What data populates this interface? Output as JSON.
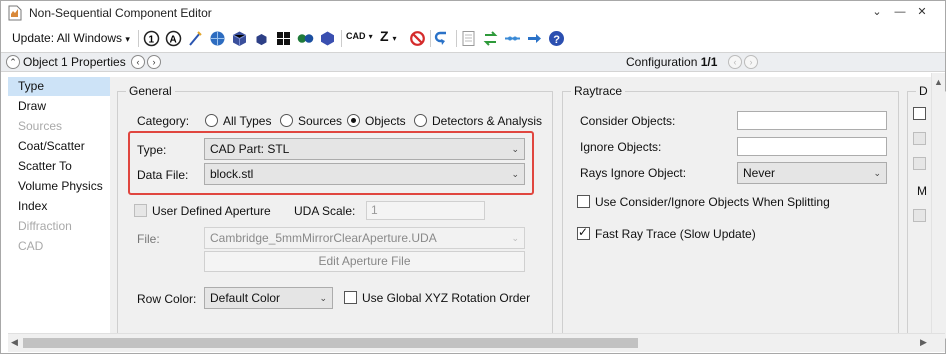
{
  "window": {
    "title": "Non-Sequential Component Editor"
  },
  "toolbar": {
    "update_label": "Update: All Windows",
    "cad_label": "CAD",
    "z_label": "Z",
    "icons": [
      "one-icon",
      "a-icon",
      "wand-icon",
      "globe-icon",
      "cube-icon",
      "cube-small-icon",
      "grid-icon",
      "spheres-icon",
      "hexagon-icon",
      "no-icon",
      "undo-icon",
      "page-icon",
      "arrows-icon",
      "dots-icon",
      "arrow-right-icon",
      "help-icon"
    ]
  },
  "propbar": {
    "title": "Object 1 Properties",
    "config_prefix": "Configuration ",
    "config_value": "1/1"
  },
  "nav": {
    "items": [
      {
        "label": "Type",
        "selected": true,
        "enabled": true
      },
      {
        "label": "Draw",
        "enabled": true
      },
      {
        "label": "Sources",
        "enabled": false
      },
      {
        "label": "Coat/Scatter",
        "enabled": true
      },
      {
        "label": "Scatter To",
        "enabled": true
      },
      {
        "label": "Volume Physics",
        "enabled": true
      },
      {
        "label": "Index",
        "enabled": true
      },
      {
        "label": "Diffraction",
        "enabled": false
      },
      {
        "label": "CAD",
        "enabled": false
      }
    ]
  },
  "general": {
    "title": "General",
    "category_label": "Category:",
    "category_options": [
      "All Types",
      "Sources",
      "Objects",
      "Detectors & Analysis"
    ],
    "category_selected": "Objects",
    "type_label": "Type:",
    "type_value": "CAD Part: STL",
    "data_file_label": "Data File:",
    "data_file_value": "block.stl",
    "uda_checkbox_label": "User Defined Aperture",
    "uda_scale_label": "UDA Scale:",
    "uda_scale_value": "1",
    "file_label": "File:",
    "file_value": "Cambridge_5mmMirrorClearAperture.UDA",
    "edit_aperture_button": "Edit Aperture File",
    "row_color_label": "Row Color:",
    "row_color_value": "Default Color",
    "global_xyz_label": "Use Global XYZ Rotation Order"
  },
  "raytrace": {
    "title": "Raytrace",
    "consider_label": "Consider Objects:",
    "consider_value": "",
    "ignore_label": "Ignore Objects:",
    "ignore_value": "",
    "rays_ignore_label": "Rays Ignore Object:",
    "rays_ignore_value": "Never",
    "splitting_label": "Use Consider/Ignore Objects When Splitting",
    "fast_ray_label": "Fast Ray Trace (Slow Update)"
  },
  "third_group": {
    "title": "D",
    "partial_label": "M"
  },
  "colors": {
    "highlight": "#e0463f",
    "selection": "#cde3f7",
    "accent": "#2a72c8"
  }
}
